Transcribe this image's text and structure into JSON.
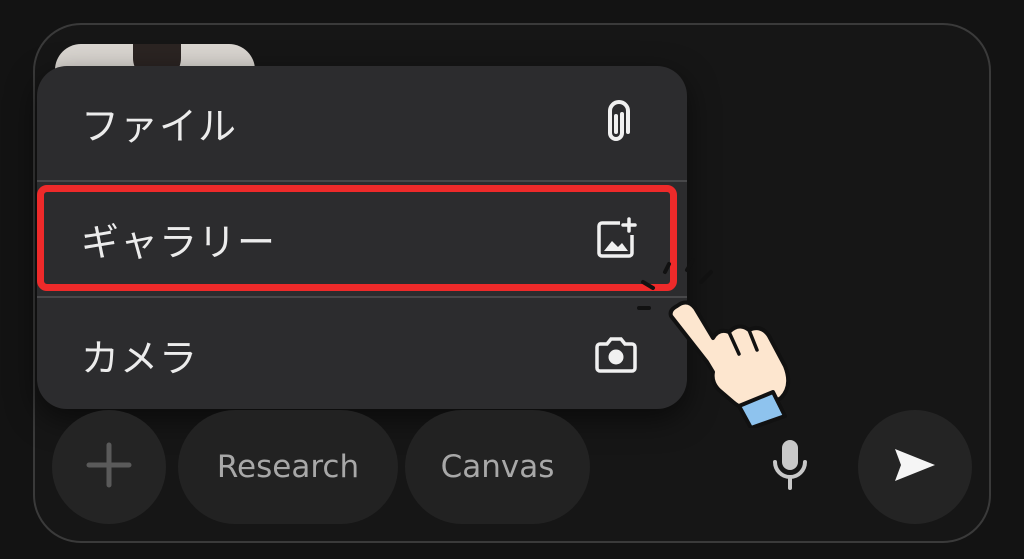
{
  "menu": {
    "items": [
      {
        "label": "ファイル",
        "icon": "paperclip-icon"
      },
      {
        "label": "ギャラリー",
        "icon": "add-image-icon"
      },
      {
        "label": "カメラ",
        "icon": "camera-icon"
      }
    ]
  },
  "toolbar": {
    "plus_icon": "plus-icon",
    "research_label": "Research",
    "canvas_label": "Canvas",
    "mic_icon": "microphone-icon",
    "send_icon": "send-icon"
  },
  "colors": {
    "highlight": "#ee2a2a",
    "menu_bg": "#2c2c2e",
    "page_bg": "#131313"
  }
}
